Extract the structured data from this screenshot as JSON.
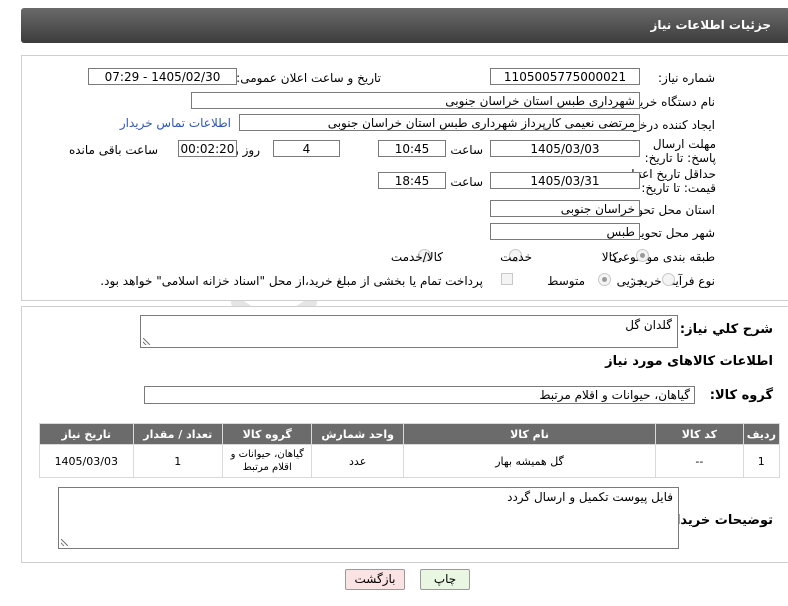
{
  "header": {
    "title": "جزئیات اطلاعات نیاز"
  },
  "labels": {
    "need_number": "شماره نیاز:",
    "announce_datetime": "تاریخ و ساعت اعلان عمومی:",
    "buyer_org": "نام دستگاه خریدار:",
    "requester": "ایجاد کننده درخواست:",
    "reply_deadline": "مهلت ارسال پاسخ: تا تاریخ:",
    "price_validity": "حداقل تاریخ اعتبار قیمت: تا تاریخ:",
    "time": "ساعت",
    "day_and": "روز و",
    "remaining": "ساعت باقی مانده",
    "delivery_province": "استان محل تحویل:",
    "delivery_city": "شهر محل تحویل:",
    "category": "طبقه بندی موضوعی:",
    "purchase_type": "نوع فرآیند خرید :",
    "need_description": "شرح کلي نياز:",
    "goods_info": "اطلاعات کالاهای مورد نیاز",
    "goods_group": "گروه کالا:",
    "buyer_notes": "توضیحات خریدار:"
  },
  "values": {
    "need_number": "1105005775000021",
    "announce_datetime": "1405/02/30 - 07:29",
    "buyer_org": "شهرداری طبس استان خراسان جنوبی",
    "requester": "مرتضی نعیمی کارپرداز شهرداری طبس استان خراسان جنوبی",
    "contact_link": "اطلاعات تماس خریدار",
    "reply_date": "1405/03/03",
    "reply_time": "10:45",
    "days_left": "4",
    "time_left": "00:02:20",
    "price_date": "1405/03/31",
    "price_time": "18:45",
    "delivery_province": "خراسان جنوبی",
    "delivery_city": "طبس",
    "need_description": "گلدان گل",
    "goods_group": "گیاهان، حیوانات و اقلام مرتبط",
    "buyer_notes": "فایل پیوست تکمیل و ارسال گردد"
  },
  "category_options": [
    {
      "label": "کالا",
      "selected": true
    },
    {
      "label": "خدمت",
      "selected": false
    },
    {
      "label": "کالا/خدمت",
      "selected": false
    }
  ],
  "purchase_options": [
    {
      "label": "جزیی",
      "selected": false
    },
    {
      "label": "متوسط",
      "selected": true
    }
  ],
  "payment_note": "پرداخت تمام یا بخشی از مبلغ خرید،از محل \"اسناد خزانه اسلامی\" خواهد بود.",
  "table": {
    "headers": [
      "ردیف",
      "کد کالا",
      "نام کالا",
      "واحد شمارش",
      "گروه کالا",
      "تعداد / مقدار",
      "تاریخ نیاز"
    ],
    "rows": [
      [
        "1",
        "--",
        "گل همیشه بهار",
        "عدد",
        "گیاهان، حیوانات و اقلام مرتبط",
        "1",
        "1405/03/03"
      ]
    ]
  },
  "buttons": {
    "print": "چاپ",
    "back": "بازگشت"
  },
  "watermark": "AriaTender.net",
  "colors": {
    "title_bar": "#4a4a4a",
    "table_header": "#6b6b6b",
    "link": "#2f58b3",
    "print_button": "#e9f7e2",
    "back_button": "#fbe3e3"
  }
}
